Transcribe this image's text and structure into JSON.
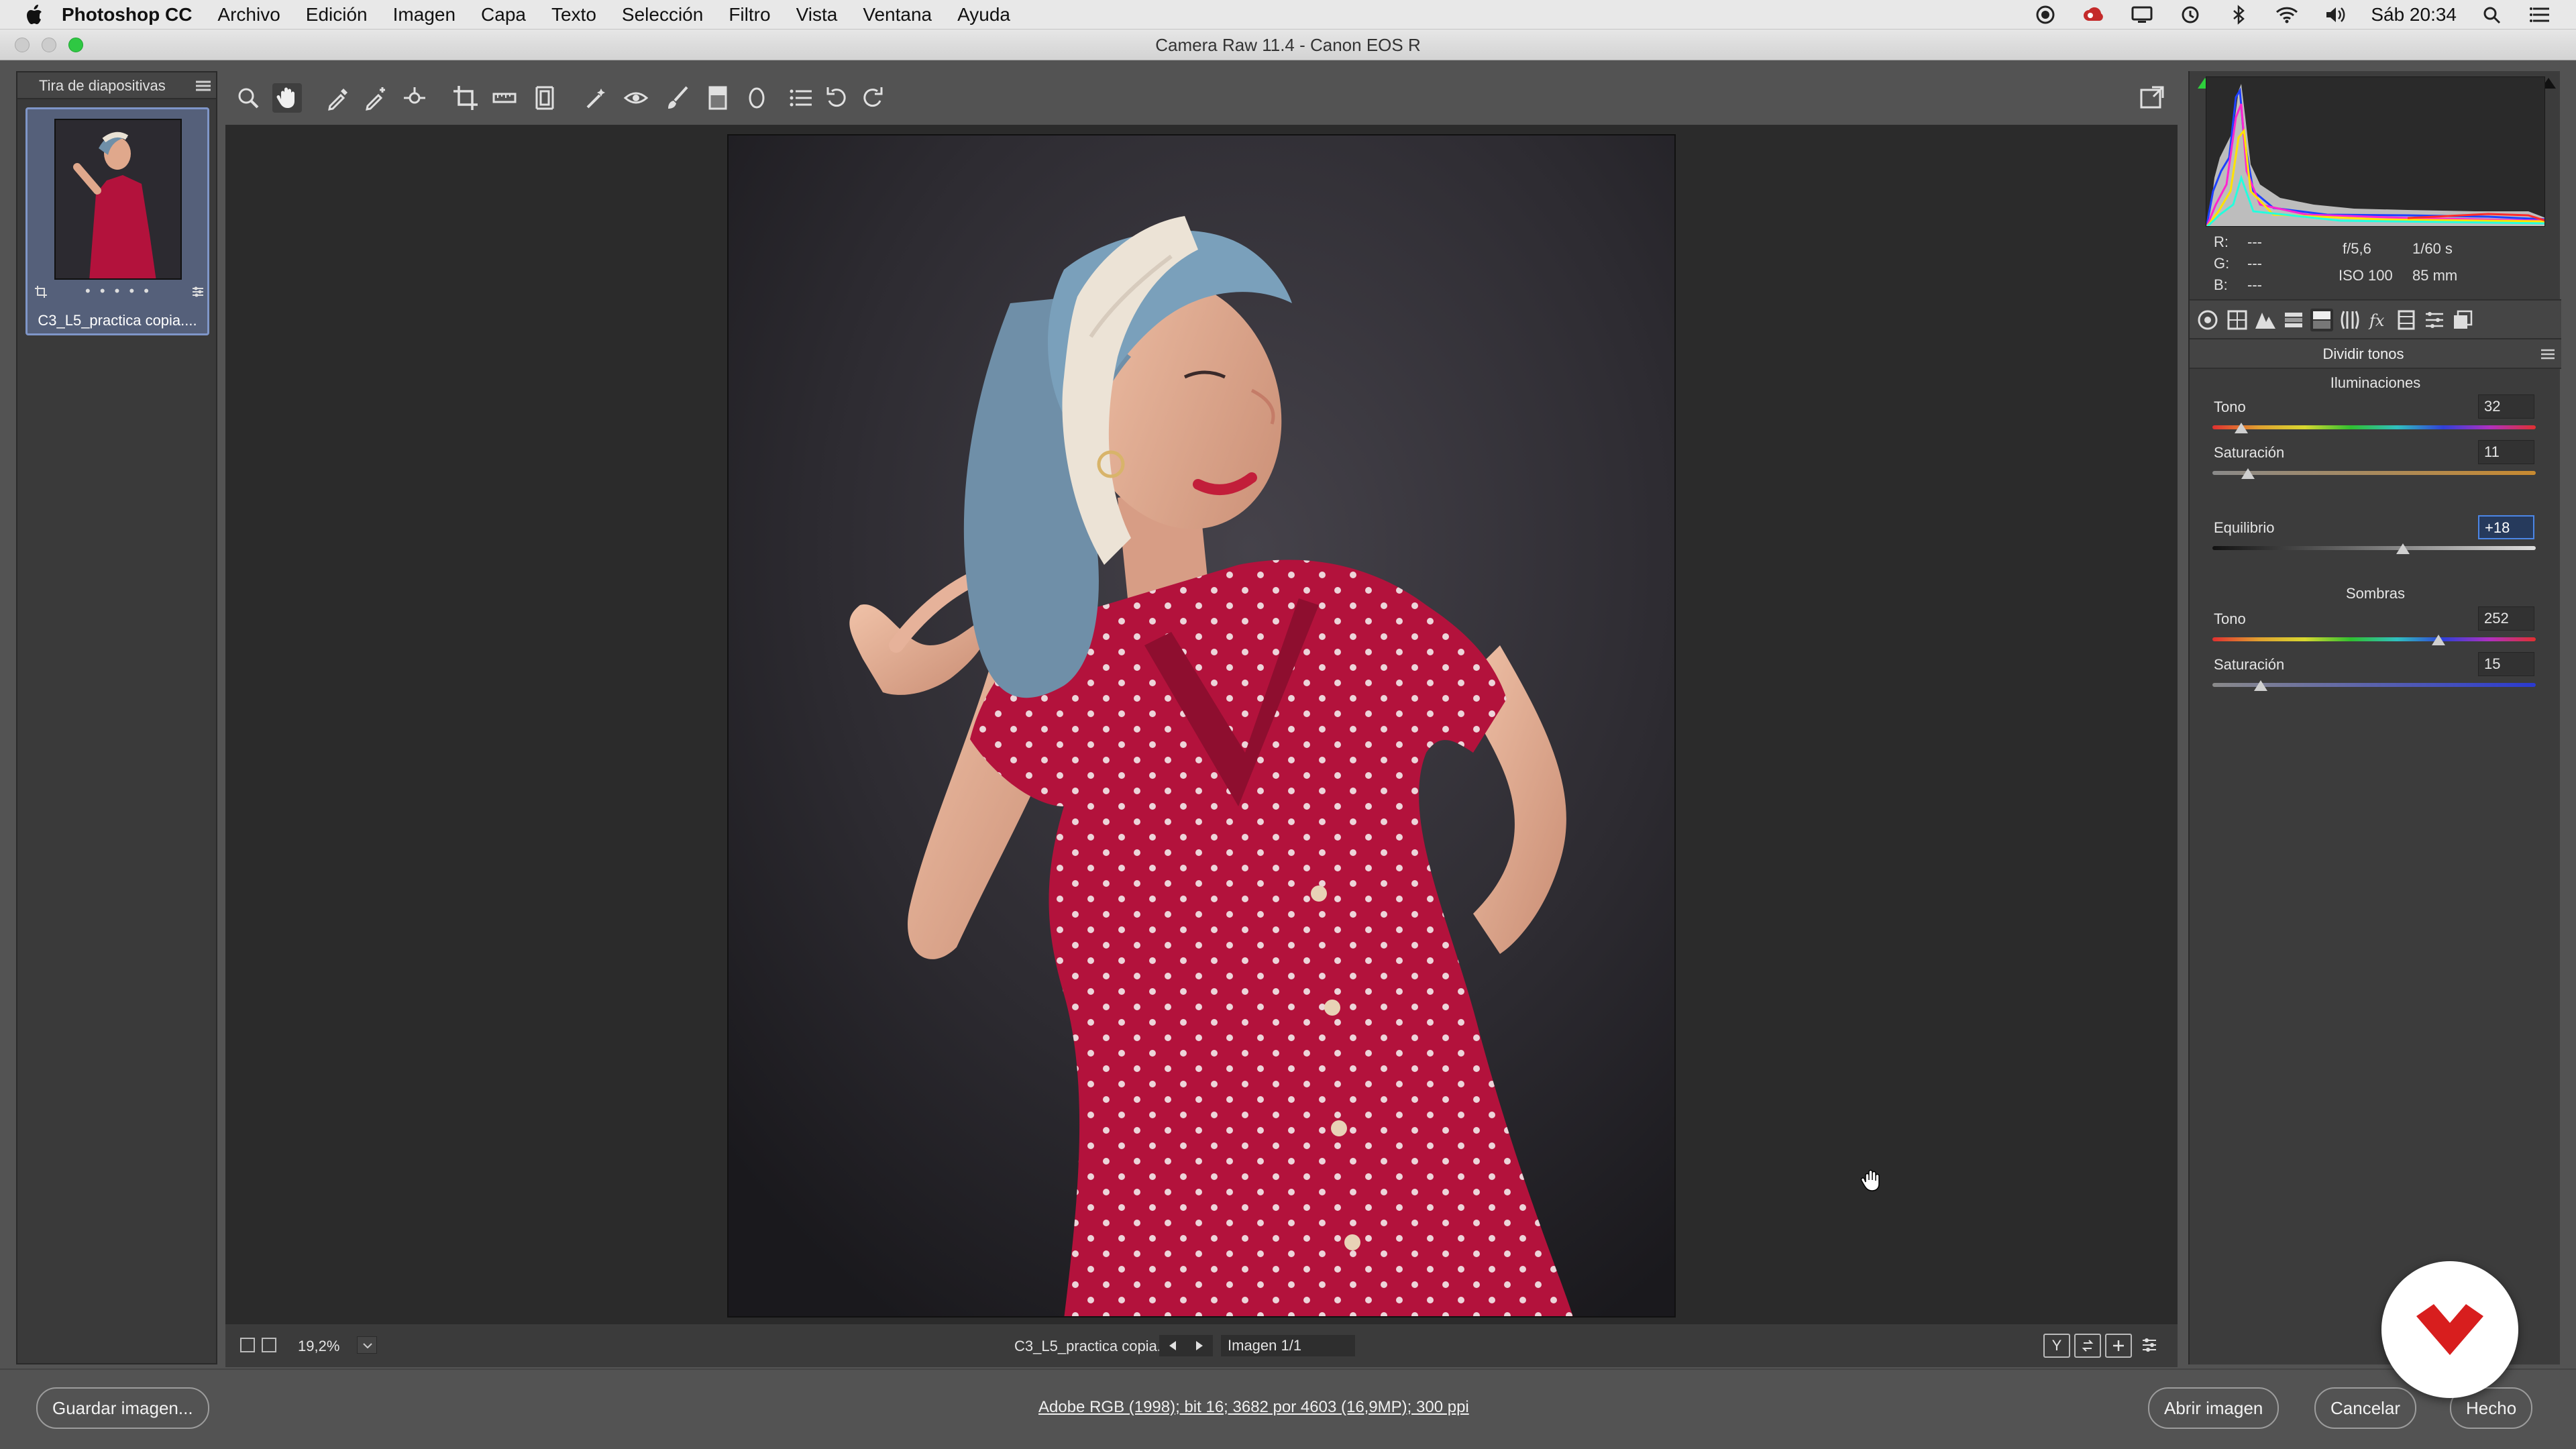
{
  "menubar": {
    "app_name": "Photoshop CC",
    "items": [
      "Archivo",
      "Edición",
      "Imagen",
      "Capa",
      "Texto",
      "Selección",
      "Filtro",
      "Vista",
      "Ventana",
      "Ayuda"
    ],
    "clock": "Sáb 20:34",
    "status_icons": [
      "record-icon",
      "creative-cloud-icon",
      "display-icon",
      "time-machine-icon",
      "bluetooth-icon",
      "wifi-icon",
      "volume-icon",
      "search-icon",
      "notification-center-icon"
    ]
  },
  "window": {
    "title": "Camera Raw 11.4 -  Canon EOS R"
  },
  "filmstrip": {
    "title": "Tira de diapositivas",
    "thumb_label": "C3_L5_practica copia....",
    "rating_dots": "• • • • •"
  },
  "toolbar": {
    "tools": [
      "zoom-tool",
      "hand-tool",
      "white-balance-tool",
      "color-sampler-tool",
      "targeted-adjustment-tool",
      "crop-tool",
      "straighten-tool",
      "transform-tool",
      "spot-removal-tool",
      "red-eye-tool",
      "adjustment-brush-tool",
      "graduated-filter-tool",
      "radial-filter-tool",
      "preferences-tool",
      "rotate-left-tool",
      "rotate-right-tool"
    ],
    "toggle_fullscreen": "fullscreen-icon"
  },
  "preview": {
    "zoom": "19,2%",
    "file_name": "C3_L5_practica copia.dng",
    "image_count": "Imagen 1/1",
    "view_buttons": [
      "Y",
      "",
      "",
      ""
    ]
  },
  "info": {
    "r_label": "R:",
    "g_label": "G:",
    "b_label": "B:",
    "r_value": "---",
    "g_value": "---",
    "b_value": "---",
    "aperture": "f/5,6",
    "shutter": "1/60 s",
    "iso": "ISO 100",
    "focal": "85 mm"
  },
  "panel": {
    "title": "Dividir tonos",
    "highlights": {
      "heading": "Iluminaciones",
      "hue_label": "Tono",
      "hue_value": "32",
      "hue_fraction": 0.09,
      "sat_label": "Saturación",
      "sat_value": "11",
      "sat_fraction": 0.11
    },
    "balance": {
      "label": "Equilibrio",
      "value": "+18",
      "fraction": 0.59
    },
    "shadows": {
      "heading": "Sombras",
      "hue_label": "Tono",
      "hue_value": "252",
      "hue_fraction": 0.7,
      "sat_label": "Saturación",
      "sat_value": "15",
      "sat_fraction": 0.15
    }
  },
  "bottom": {
    "save_label": "Guardar imagen...",
    "workflow": "Adobe RGB (1998); bit 16; 3682 por 4603 (16,9MP); 300 ppi",
    "open_label": "Abrir imagen",
    "cancel_label": "Cancelar",
    "done_label": "Hecho"
  },
  "colors": {
    "accent": "#4b86e6",
    "dress_red": "#b3123c",
    "brand_red": "#d81e1e"
  }
}
